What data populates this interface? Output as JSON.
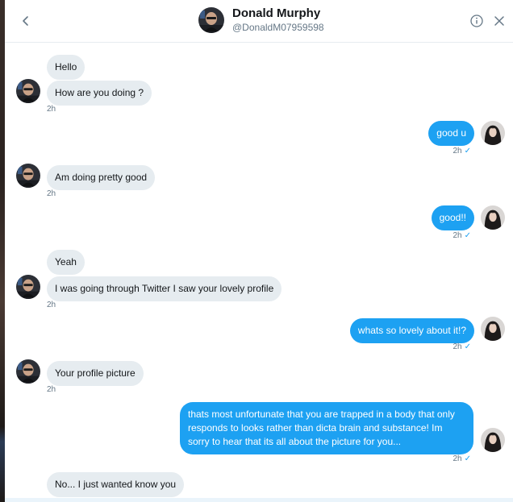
{
  "header": {
    "name": "Donald Murphy",
    "handle": "@DonaldM07959598"
  },
  "icons": {
    "back": "chevron-left-icon",
    "info": "info-icon",
    "close": "close-icon"
  },
  "colors": {
    "outgoing_bubble": "#1da1f2",
    "incoming_bubble": "#e6ecf0",
    "timestamp": "#657786"
  },
  "messages": [
    {
      "from": "Donald Murphy",
      "text": "Hello"
    },
    {
      "from": "Donald Murphy",
      "text": "How are you doing ?",
      "time": "2h"
    },
    {
      "from": "me",
      "text": "good u",
      "time": "2h"
    },
    {
      "from": "Donald Murphy",
      "text": "Am doing pretty good",
      "time": "2h"
    },
    {
      "from": "me",
      "text": "good!!",
      "time": "2h"
    },
    {
      "from": "Donald Murphy",
      "text": "Yeah"
    },
    {
      "from": "Donald Murphy",
      "text": "I was going through Twitter I saw your lovely profile",
      "time": "2h"
    },
    {
      "from": "me",
      "text": "whats so lovely about it!?",
      "time": "2h"
    },
    {
      "from": "Donald Murphy",
      "text": "Your profile picture",
      "time": "2h"
    },
    {
      "from": "me",
      "text": "thats most unfortunate that you are trapped in a body that only responds to looks rather than dicta brain and substance! Im sorry to hear that its all about the picture for you...",
      "time": "2h"
    },
    {
      "from": "Donald Murphy",
      "text": "No... I just wanted know you"
    }
  ]
}
